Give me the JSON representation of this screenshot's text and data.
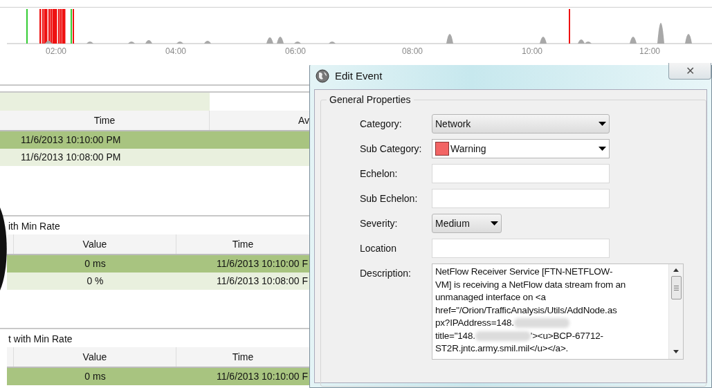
{
  "timeline": {
    "axis_labels": [
      "02:00",
      "04:00",
      "06:00",
      "08:00",
      "10:00",
      "12:00"
    ]
  },
  "panel": {
    "table_1": {
      "columns": [
        "Time",
        "Av"
      ],
      "rows": [
        {
          "cells": [
            "11/6/2013 10:10:00 PM"
          ],
          "selected": true
        },
        {
          "cells": [
            "11/6/2013 10:08:00 PM"
          ],
          "selected": false
        }
      ]
    },
    "section_2": {
      "title": "ith Min Rate",
      "columns": [
        "Value",
        "Time"
      ],
      "rows": [
        {
          "cells": [
            "0 ms",
            "11/6/2013 10:10:00 F"
          ],
          "selected": true
        },
        {
          "cells": [
            "0 %",
            "11/6/2013 10:08:00 F"
          ],
          "selected": false
        }
      ]
    },
    "section_3": {
      "title": "t with Min Rate",
      "columns": [
        "Value",
        "Time"
      ],
      "rows": [
        {
          "cells": [
            "0 ms",
            "11/6/2013 10:10:00 F"
          ],
          "selected": true
        }
      ]
    }
  },
  "dialog": {
    "title": "Edit Event",
    "close": "✕",
    "group": "General Properties",
    "fields": [
      {
        "label": "Category:",
        "kind": "dropdown",
        "value": "Network"
      },
      {
        "label": "Sub Category:",
        "kind": "color-dropdown",
        "value": "Warning",
        "color": "#f26464"
      },
      {
        "label": "Echelon:",
        "kind": "text"
      },
      {
        "label": "Sub Echelon:",
        "kind": "text"
      },
      {
        "label": "Severity:",
        "kind": "small-dropdown",
        "value": "Medium"
      },
      {
        "label": "Location",
        "kind": "text"
      },
      {
        "label": "Description:",
        "kind": "memo",
        "lines": [
          [
            {
              "kind": "text",
              "text": "NetFlow Receiver Service [FTN-NETFLOW-"
            }
          ],
          [
            {
              "kind": "text",
              "text": "VM] is receiving a NetFlow data stream from an"
            }
          ],
          [
            {
              "kind": "text",
              "text": "unmanaged interface on <a"
            }
          ],
          [
            {
              "kind": "text",
              "text": "href=\"/Orion/TrafficAnalysis/Utils/AddNode.as"
            }
          ],
          [
            {
              "kind": "text",
              "text": "px?IPAddress=148."
            },
            {
              "kind": "redacted"
            }
          ],
          [
            {
              "kind": "text",
              "text": "title=\"148."
            },
            {
              "kind": "redacted"
            },
            {
              "kind": "text",
              "text": "'><u>BCP-67712-"
            }
          ],
          [
            {
              "kind": "text",
              "text": "ST2R.jntc.army.smil.mil</u></a>."
            }
          ]
        ]
      }
    ]
  }
}
